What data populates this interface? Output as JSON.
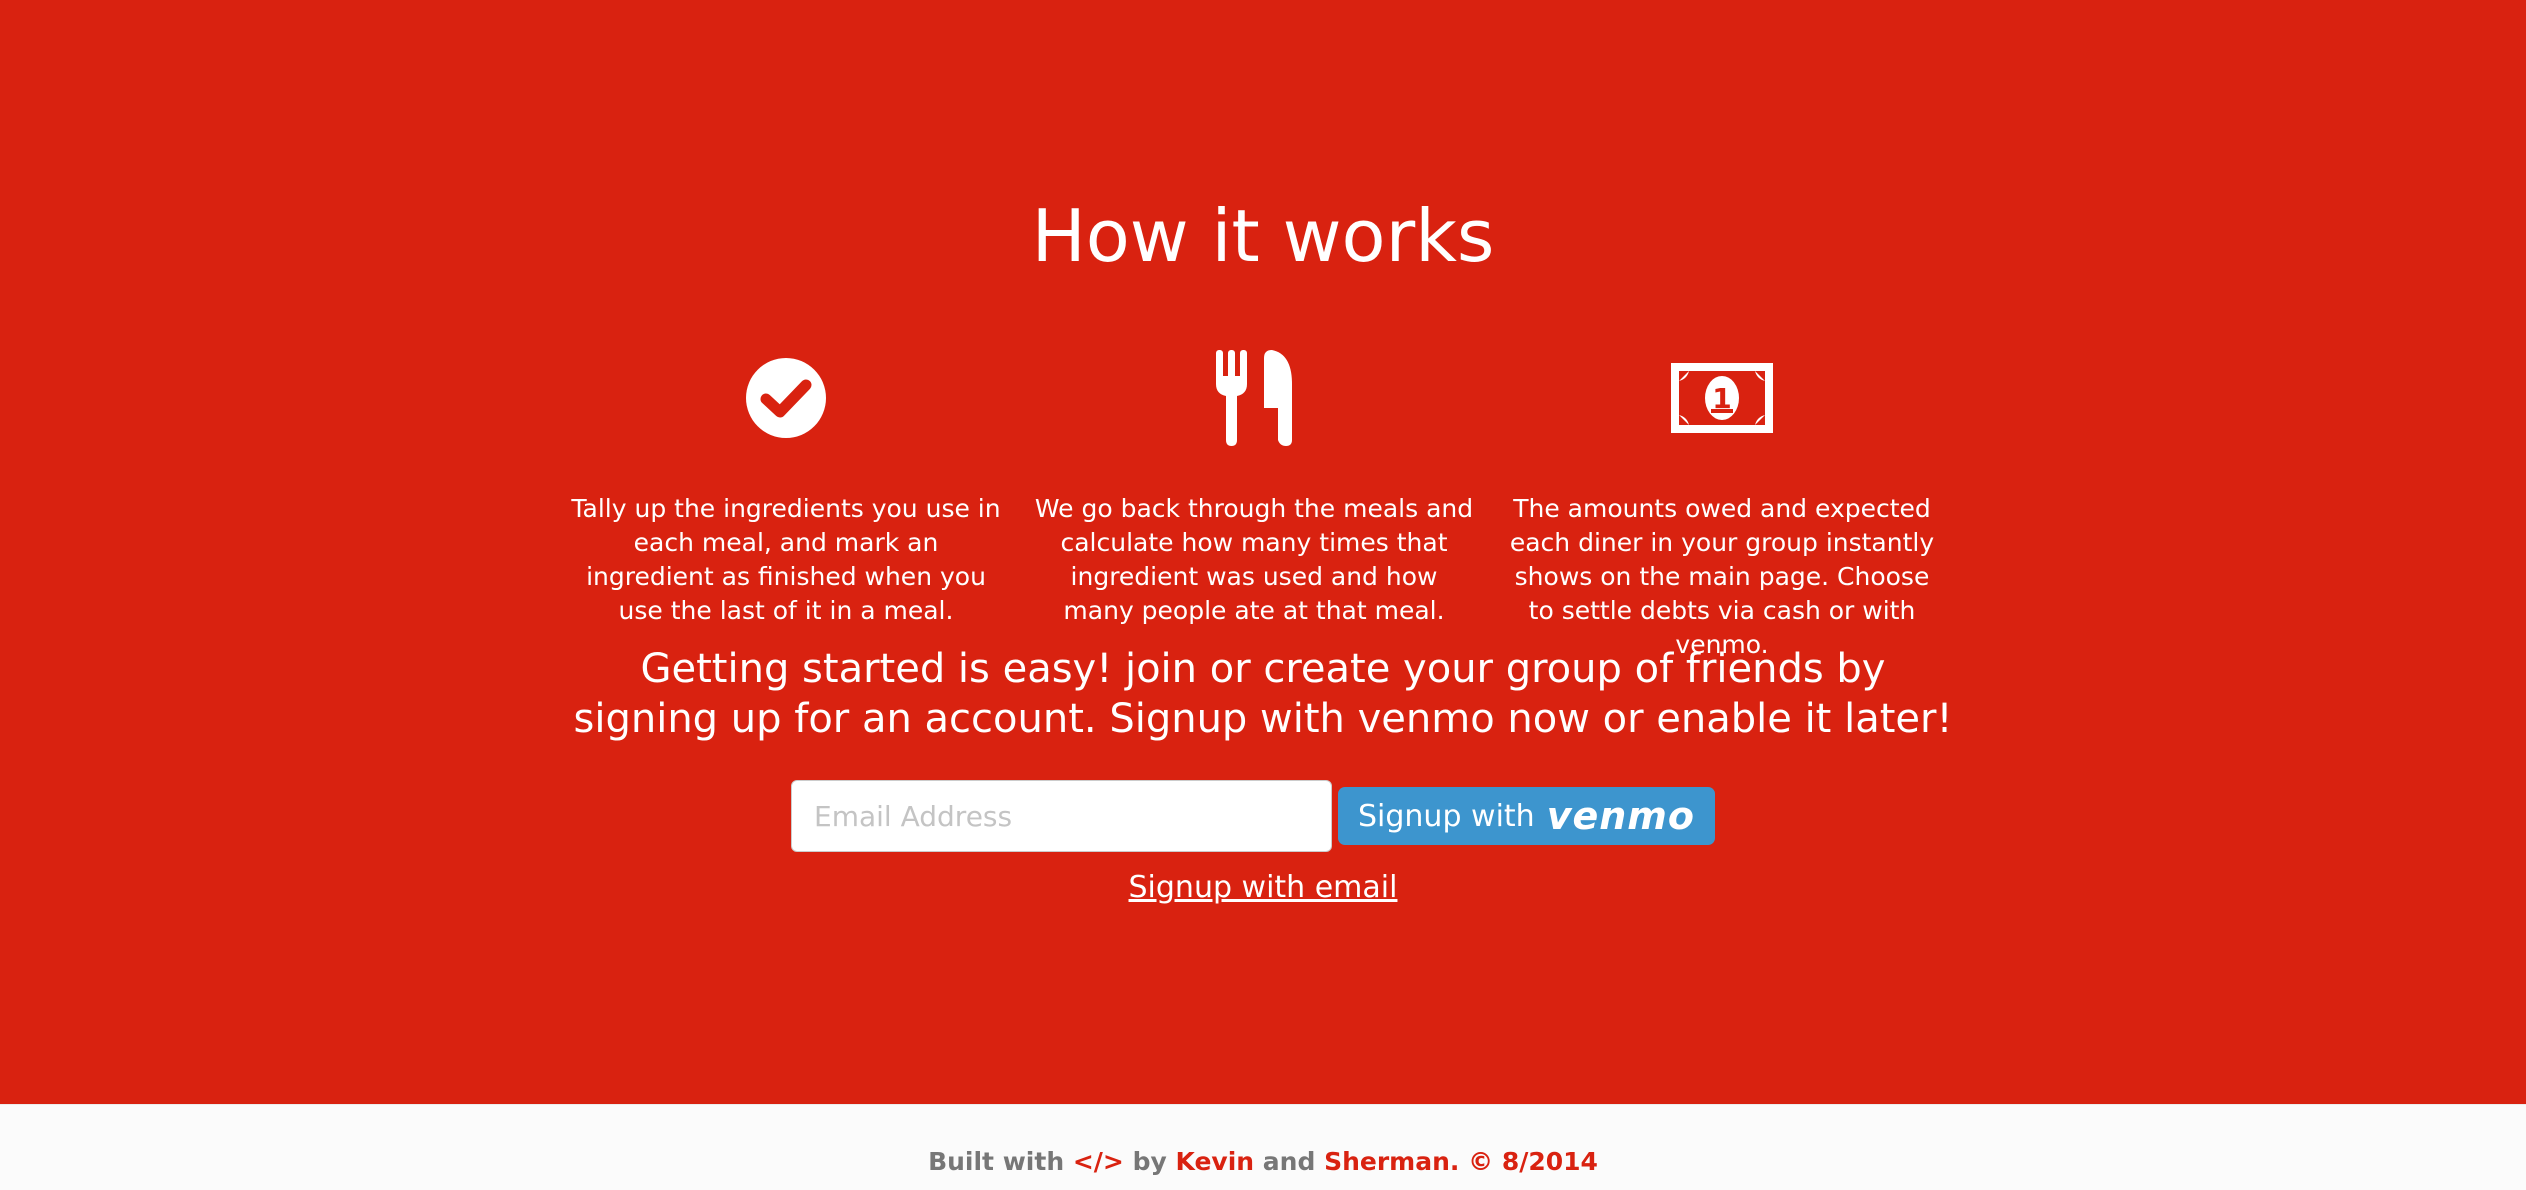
{
  "hero": {
    "title": "How it works",
    "background_color": "#d92210",
    "features": [
      {
        "icon": "check-circle-icon",
        "text": "Tally up the ingredients you use in each meal, and mark an ingredient as finished when you use the last of it in a meal."
      },
      {
        "icon": "fork-knife-icon",
        "text": "We go back through the meals and calculate how many times that ingredient was used and how many people ate at that meal."
      },
      {
        "icon": "money-bill-icon",
        "text": "The amounts owed and expected each diner in your group instantly shows on the main page. Choose to settle debts via cash or with venmo."
      }
    ],
    "cta_text": "Getting started is easy! join or create your group of friends by signing up for an account. Signup with venmo now or enable it later!",
    "signup": {
      "email_placeholder": "Email Address",
      "email_value": "",
      "venmo_button_prefix": "Signup with",
      "venmo_logo": "venmo",
      "venmo_color": "#3d95ce"
    },
    "email_link": "Signup with email"
  },
  "footer": {
    "built_with": "Built with",
    "code_icon": "</>",
    "by": "by",
    "author1": "Kevin",
    "and": "and",
    "author2": "Sherman.",
    "copyright": "© 8/2014"
  }
}
